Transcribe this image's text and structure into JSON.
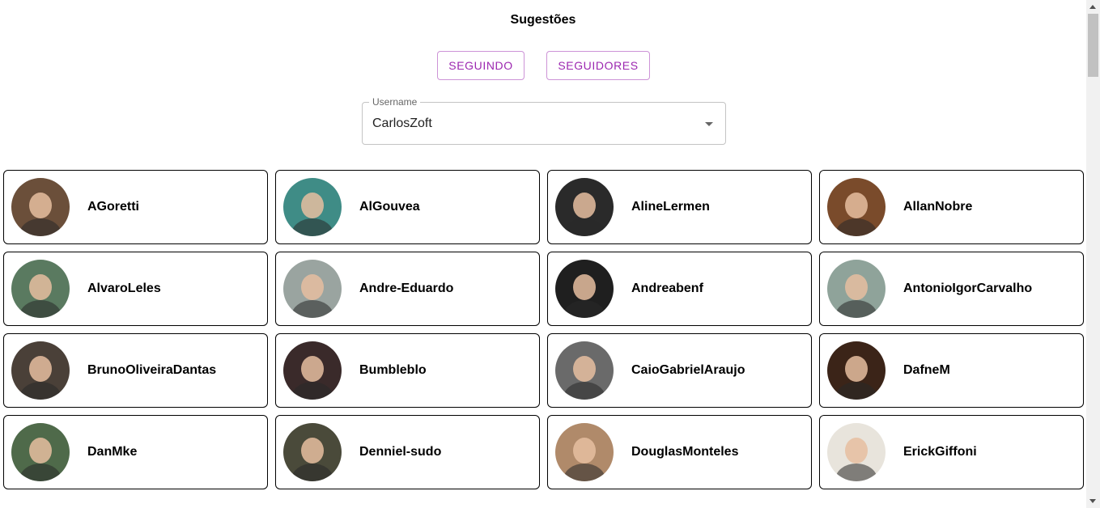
{
  "header": {
    "title": "Sugestões"
  },
  "buttons": {
    "following_label": "SEGUINDO",
    "followers_label": "SEGUIDORES"
  },
  "user_select": {
    "label": "Username",
    "value": "CarlosZoft"
  },
  "colors": {
    "accent": "#9c27b0",
    "card_border": "#000000"
  },
  "users": [
    {
      "username": "AGoretti",
      "avatar_bg": "#6b4f3a"
    },
    {
      "username": "AlGouvea",
      "avatar_bg": "#3f8c86"
    },
    {
      "username": "AlineLermen",
      "avatar_bg": "#2a2a2a"
    },
    {
      "username": "AllanNobre",
      "avatar_bg": "#7a4b2b"
    },
    {
      "username": "AlvaroLeles",
      "avatar_bg": "#5a7a60"
    },
    {
      "username": "Andre-Eduardo",
      "avatar_bg": "#9aa4a0"
    },
    {
      "username": "Andreabenf",
      "avatar_bg": "#1f1f1f"
    },
    {
      "username": "AntonioIgorCarvalho",
      "avatar_bg": "#8fa39a"
    },
    {
      "username": "BrunoOliveiraDantas",
      "avatar_bg": "#4a4038"
    },
    {
      "username": "Bumbleblo",
      "avatar_bg": "#3a2a2a"
    },
    {
      "username": "CaioGabrielAraujo",
      "avatar_bg": "#6a6a6a"
    },
    {
      "username": "DafneM",
      "avatar_bg": "#3b2418"
    },
    {
      "username": "DanMke",
      "avatar_bg": "#4f6a4a"
    },
    {
      "username": "Denniel-sudo",
      "avatar_bg": "#4a4a3a"
    },
    {
      "username": "DouglasMonteles",
      "avatar_bg": "#b08a6a"
    },
    {
      "username": "ErickGiffoni",
      "avatar_bg": "#e8e4dc"
    }
  ]
}
